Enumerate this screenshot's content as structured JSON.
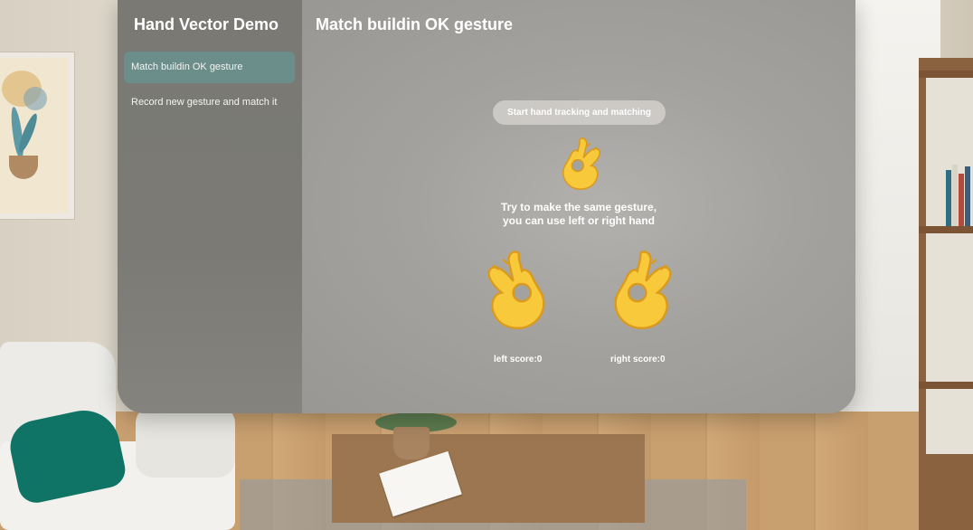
{
  "sidebar": {
    "title": "Hand Vector Demo",
    "items": [
      {
        "label": "Match buildin OK gesture",
        "selected": true
      },
      {
        "label": "Record new gesture and match it",
        "selected": false
      }
    ]
  },
  "detail": {
    "title": "Match buildin OK gesture",
    "start_button_label": "Start hand tracking and matching",
    "instruction_line1": "Try to make the same gesture,",
    "instruction_line2": "you can use left or right hand",
    "left_score_label": "left score:0",
    "right_score_label": "right score:0",
    "gesture_icon": "ok-hand-icon"
  },
  "colors": {
    "selected_item_bg": "#6c8e8b",
    "sidebar_bg": "#7a7974",
    "detail_bg": "#a4a29e",
    "emoji_yellow": "#f9c93c",
    "text": "#ffffff"
  }
}
